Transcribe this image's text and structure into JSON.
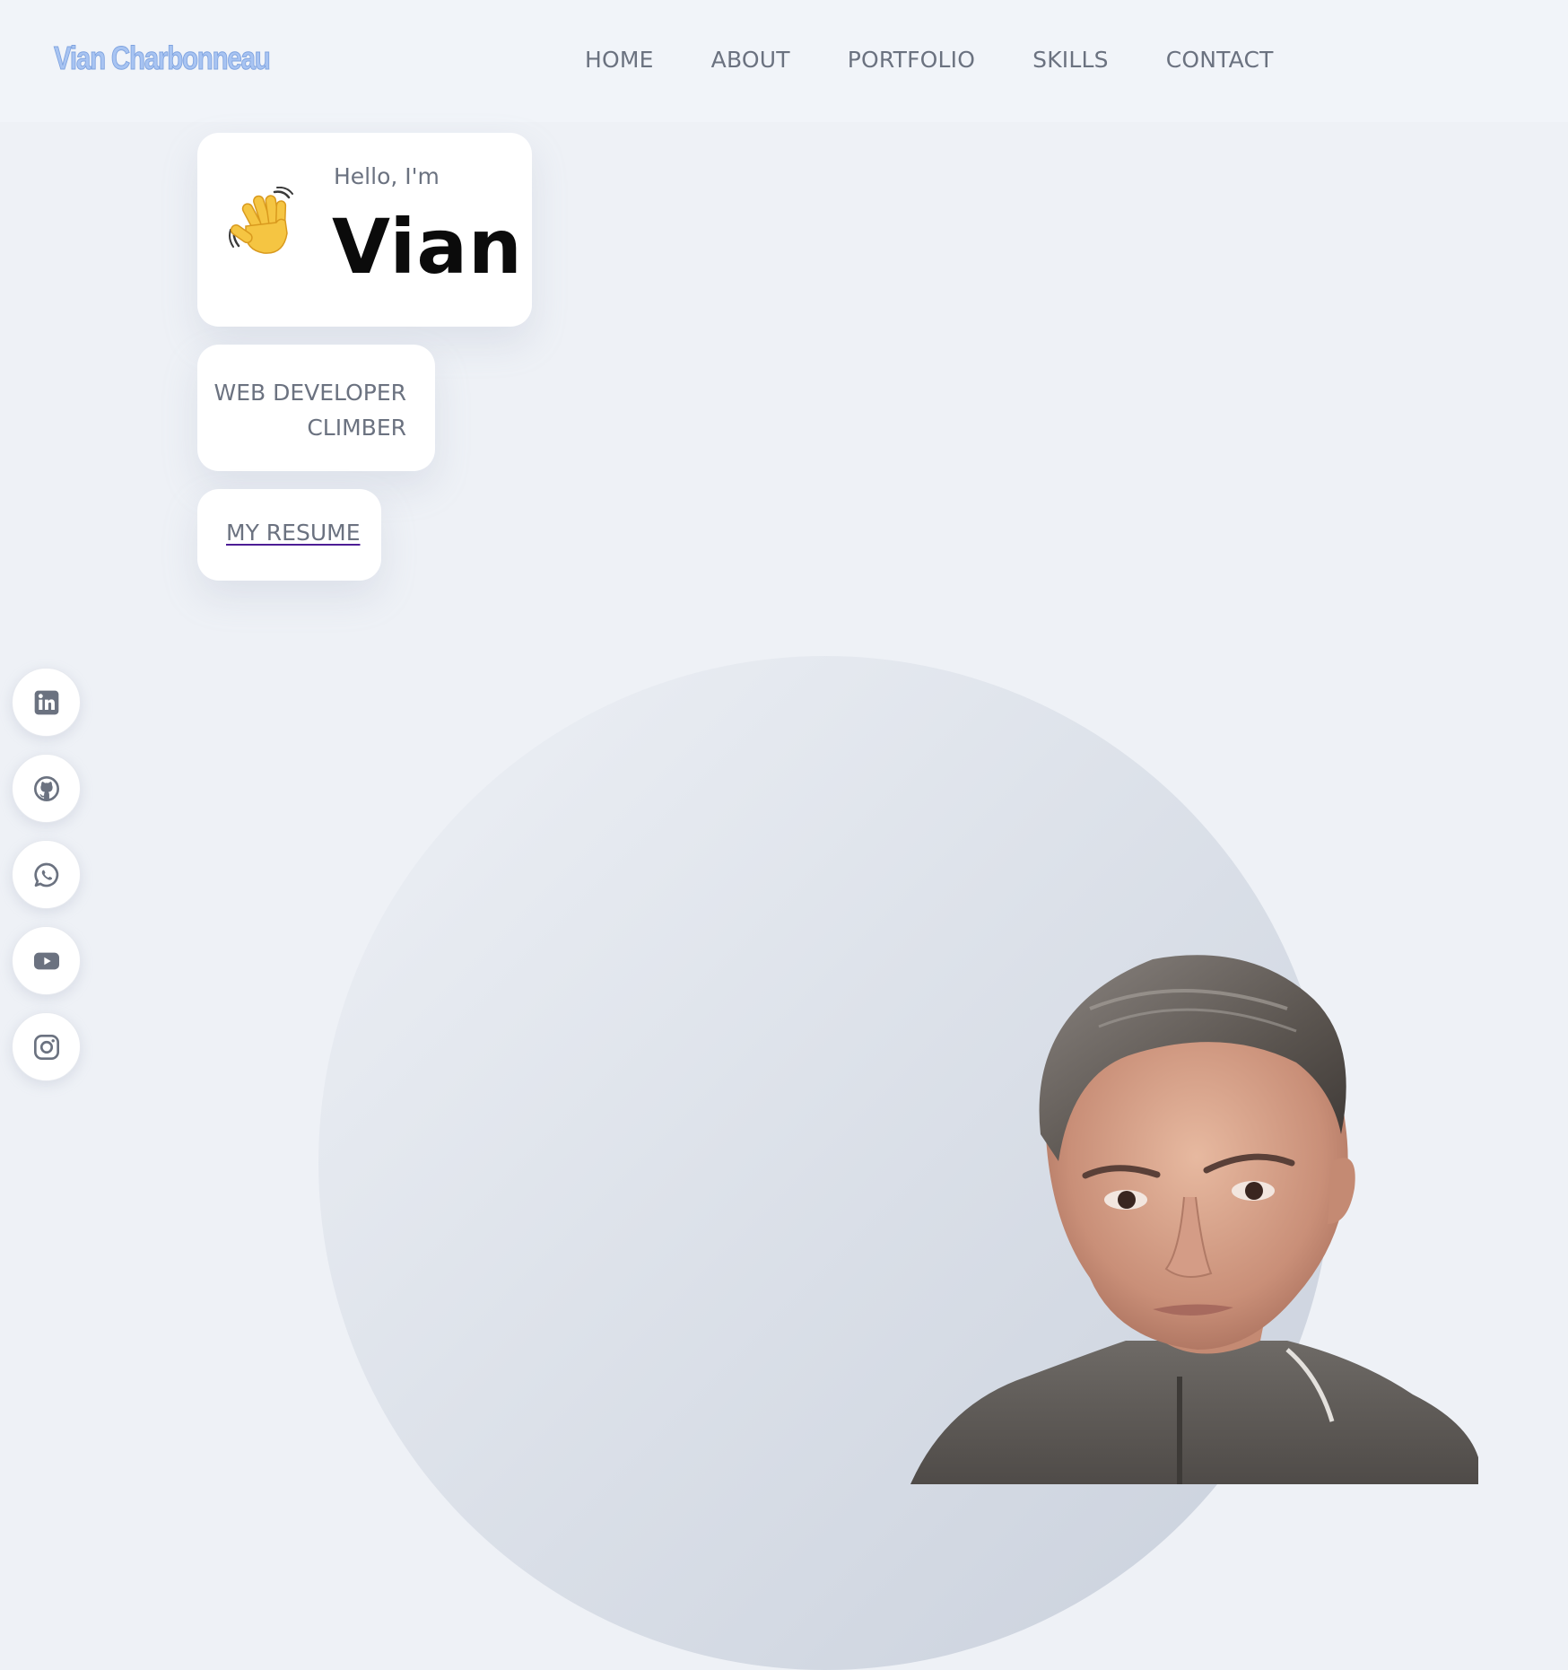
{
  "header": {
    "logo": "Vian Charbonneau",
    "nav": [
      "HOME",
      "ABOUT",
      "PORTFOLIO",
      "SKILLS",
      "CONTACT"
    ]
  },
  "hero": {
    "greeting": "Hello, I'm",
    "name": "Vian",
    "wave_icon": "waving-hand-icon",
    "roles": [
      "WEB DEVELOPER",
      "CLIMBER"
    ],
    "resume_link": "MY RESUME"
  },
  "social": [
    "linkedin-icon",
    "github-icon",
    "whatsapp-icon",
    "youtube-icon",
    "instagram-icon"
  ],
  "colors": {
    "background": "#eef1f6",
    "header": "#f1f4f9",
    "logo": "#a8c4f2",
    "text_muted": "#6b7280",
    "name": "#0b0b0b",
    "card": "#ffffff"
  }
}
